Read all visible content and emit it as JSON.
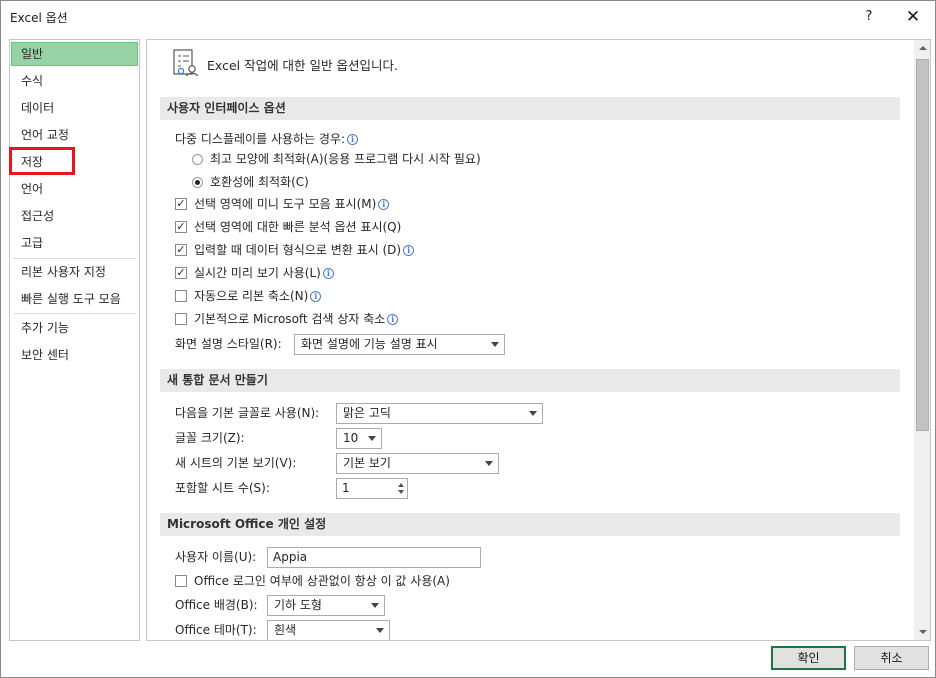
{
  "window": {
    "title": "Excel 옵션",
    "help_label": "?",
    "close_label": "✕"
  },
  "sidebar": {
    "items": [
      {
        "label": "일반"
      },
      {
        "label": "수식"
      },
      {
        "label": "데이터"
      },
      {
        "label": "언어 교정"
      },
      {
        "label": "저장"
      },
      {
        "label": "언어"
      },
      {
        "label": "접근성"
      },
      {
        "label": "고급"
      },
      {
        "label": "리본 사용자 지정"
      },
      {
        "label": "빠른 실행 도구 모음"
      },
      {
        "label": "추가 기능"
      },
      {
        "label": "보안 센터"
      }
    ],
    "selected": "일반",
    "highlighted": "저장"
  },
  "content": {
    "header_text": "Excel 작업에 대한 일반 옵션입니다.",
    "sections": {
      "ui": {
        "title": "사용자 인터페이스 옵션",
        "multi_display_label": "다중 디스플레이를 사용하는 경우:",
        "radio_appearance": "최고 모양에 최적화(A)(응용 프로그램 다시 시작 필요)",
        "radio_compat": "호환성에 최적화(C)",
        "cb_mini_toolbar": "선택 영역에 미니 도구 모음 표시(M)",
        "cb_quick_analysis": "선택 영역에 대한 빠른 분석 옵션 표시(Q)",
        "cb_convert_data": "입력할 때 데이터 형식으로 변환 표시 (D)",
        "cb_live_preview": "실시간 미리 보기 사용(L)",
        "cb_collapse_ribbon": "자동으로 리본 축소(N)",
        "cb_collapse_search": "기본적으로 Microsoft 검색 상자 축소",
        "screentip_label": "화면 설명 스타일(R):",
        "screentip_value": "화면 설명에 기능 설명 표시"
      },
      "new_workbook": {
        "title": "새 통합 문서 만들기",
        "font_label": "다음을 기본 글꼴로 사용(N):",
        "font_value": "맑은 고딕",
        "size_label": "글꼴 크기(Z):",
        "size_value": "10",
        "view_label": "새 시트의 기본 보기(V):",
        "view_value": "기본 보기",
        "sheets_label": "포함할 시트 수(S):",
        "sheets_value": "1"
      },
      "personalize": {
        "title": "Microsoft Office 개인 설정",
        "username_label": "사용자 이름(U):",
        "username_value": "Appia",
        "always_use_label": "Office 로그인 여부에 상관없이 항상 이 값 사용(A)",
        "background_label": "Office 배경(B):",
        "background_value": "기하 도형",
        "theme_label": "Office 테마(T):",
        "theme_value": "흰색"
      }
    }
  },
  "footer": {
    "ok_label": "확인",
    "cancel_label": "취소"
  },
  "colors": {
    "selected_nav": "#98d3a5",
    "highlight_box": "#e8151b",
    "primary_border": "#217346",
    "info_icon": "#4a7bcf"
  }
}
